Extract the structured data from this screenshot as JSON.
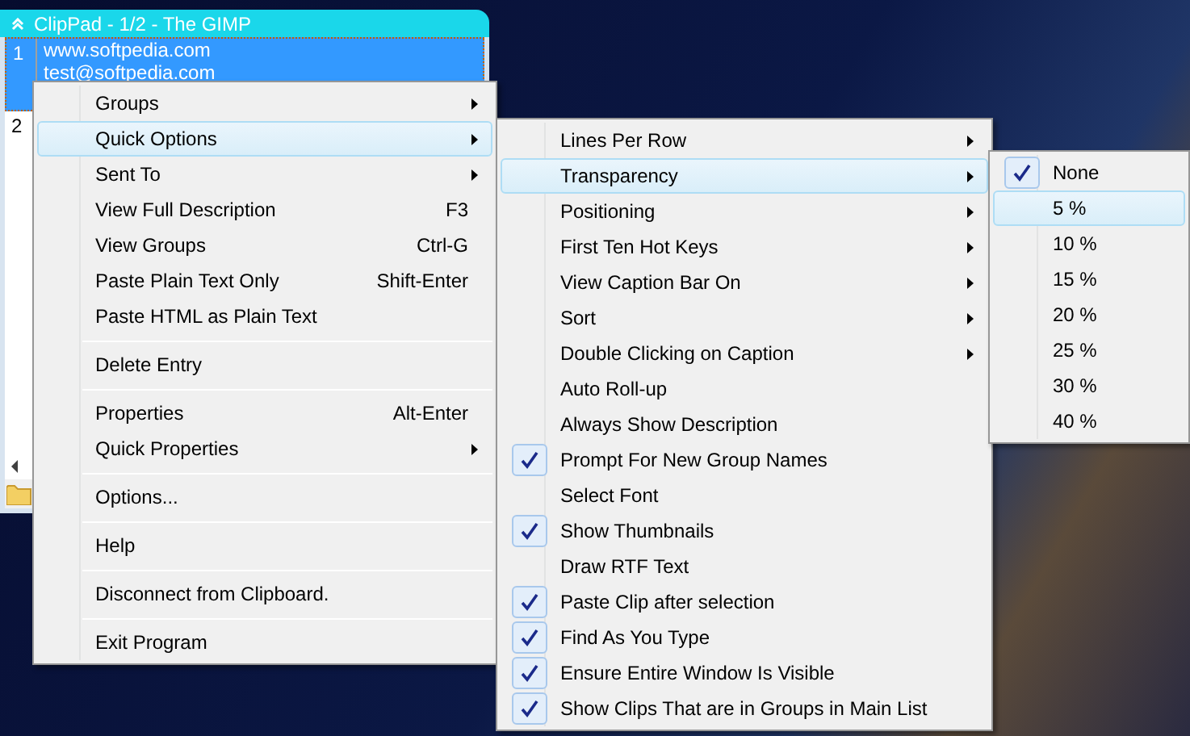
{
  "window": {
    "title": "ClipPad - 1/2 - The GIMP",
    "entries": [
      {
        "number": "1",
        "lines": [
          "www.softpedia.com",
          "test@softpedia.com"
        ],
        "selected": true
      },
      {
        "number": "2",
        "selected": false
      }
    ]
  },
  "menus": [
    {
      "items": [
        {
          "kind": "item",
          "label": "Groups",
          "submenu": true,
          "selected": false
        },
        {
          "kind": "item",
          "label": "Quick Options",
          "submenu": true,
          "selected": true
        },
        {
          "kind": "item",
          "label": "Sent To",
          "submenu": true,
          "selected": false
        },
        {
          "kind": "item",
          "label": "View Full Description",
          "shortcut": "F3",
          "submenu": false,
          "selected": false
        },
        {
          "kind": "item",
          "label": "View Groups",
          "shortcut": "Ctrl-G",
          "submenu": false,
          "selected": false
        },
        {
          "kind": "item",
          "label": "Paste Plain Text Only",
          "shortcut": "Shift-Enter",
          "submenu": false,
          "selected": false
        },
        {
          "kind": "item",
          "label": "Paste HTML as Plain Text",
          "submenu": false,
          "selected": false
        },
        {
          "kind": "separator"
        },
        {
          "kind": "item",
          "label": "Delete Entry",
          "submenu": false,
          "selected": false
        },
        {
          "kind": "separator"
        },
        {
          "kind": "item",
          "label": "Properties",
          "shortcut": "Alt-Enter",
          "submenu": false,
          "selected": false
        },
        {
          "kind": "item",
          "label": "Quick Properties",
          "submenu": true,
          "selected": false
        },
        {
          "kind": "separator"
        },
        {
          "kind": "item",
          "label": "Options...",
          "submenu": false,
          "selected": false
        },
        {
          "kind": "separator"
        },
        {
          "kind": "item",
          "label": "Help",
          "submenu": false,
          "selected": false
        },
        {
          "kind": "separator"
        },
        {
          "kind": "item",
          "label": "Disconnect from Clipboard.",
          "submenu": false,
          "selected": false
        },
        {
          "kind": "separator"
        },
        {
          "kind": "item",
          "label": "Exit Program",
          "submenu": false,
          "selected": false
        }
      ]
    },
    {
      "items": [
        {
          "kind": "item",
          "label": "Lines Per Row",
          "submenu": true,
          "selected": false,
          "checked": false
        },
        {
          "kind": "item",
          "label": "Transparency",
          "submenu": true,
          "selected": true,
          "checked": false
        },
        {
          "kind": "item",
          "label": "Positioning",
          "submenu": true,
          "selected": false,
          "checked": false
        },
        {
          "kind": "item",
          "label": "First Ten Hot Keys",
          "submenu": true,
          "selected": false,
          "checked": false
        },
        {
          "kind": "item",
          "label": "View Caption Bar On",
          "submenu": true,
          "selected": false,
          "checked": false
        },
        {
          "kind": "item",
          "label": "Sort",
          "submenu": true,
          "selected": false,
          "checked": false
        },
        {
          "kind": "item",
          "label": "Double Clicking on Caption",
          "submenu": true,
          "selected": false,
          "checked": false
        },
        {
          "kind": "item",
          "label": "Auto Roll-up",
          "submenu": false,
          "selected": false,
          "checked": false
        },
        {
          "kind": "item",
          "label": "Always Show Description",
          "submenu": false,
          "selected": false,
          "checked": false
        },
        {
          "kind": "item",
          "label": "Prompt For New Group Names",
          "submenu": false,
          "selected": false,
          "checked": true
        },
        {
          "kind": "item",
          "label": "Select Font",
          "submenu": false,
          "selected": false,
          "checked": false
        },
        {
          "kind": "item",
          "label": "Show Thumbnails",
          "submenu": false,
          "selected": false,
          "checked": true
        },
        {
          "kind": "item",
          "label": "Draw RTF Text",
          "submenu": false,
          "selected": false,
          "checked": false
        },
        {
          "kind": "item",
          "label": "Paste Clip after selection",
          "submenu": false,
          "selected": false,
          "checked": true
        },
        {
          "kind": "item",
          "label": "Find As You Type",
          "submenu": false,
          "selected": false,
          "checked": true
        },
        {
          "kind": "item",
          "label": "Ensure Entire Window Is Visible",
          "submenu": false,
          "selected": false,
          "checked": true
        },
        {
          "kind": "item",
          "label": "Show Clips That are in Groups in Main List",
          "submenu": false,
          "selected": false,
          "checked": true
        }
      ]
    },
    {
      "items": [
        {
          "kind": "item",
          "label": "None",
          "submenu": false,
          "selected": false,
          "checked": true
        },
        {
          "kind": "item",
          "label": "5 %",
          "submenu": false,
          "selected": true,
          "checked": false
        },
        {
          "kind": "item",
          "label": "10 %",
          "submenu": false,
          "selected": false,
          "checked": false
        },
        {
          "kind": "item",
          "label": "15 %",
          "submenu": false,
          "selected": false,
          "checked": false
        },
        {
          "kind": "item",
          "label": "20 %",
          "submenu": false,
          "selected": false,
          "checked": false
        },
        {
          "kind": "item",
          "label": "25 %",
          "submenu": false,
          "selected": false,
          "checked": false
        },
        {
          "kind": "item",
          "label": "30 %",
          "submenu": false,
          "selected": false,
          "checked": false
        },
        {
          "kind": "item",
          "label": "40 %",
          "submenu": false,
          "selected": false,
          "checked": false
        }
      ]
    }
  ]
}
